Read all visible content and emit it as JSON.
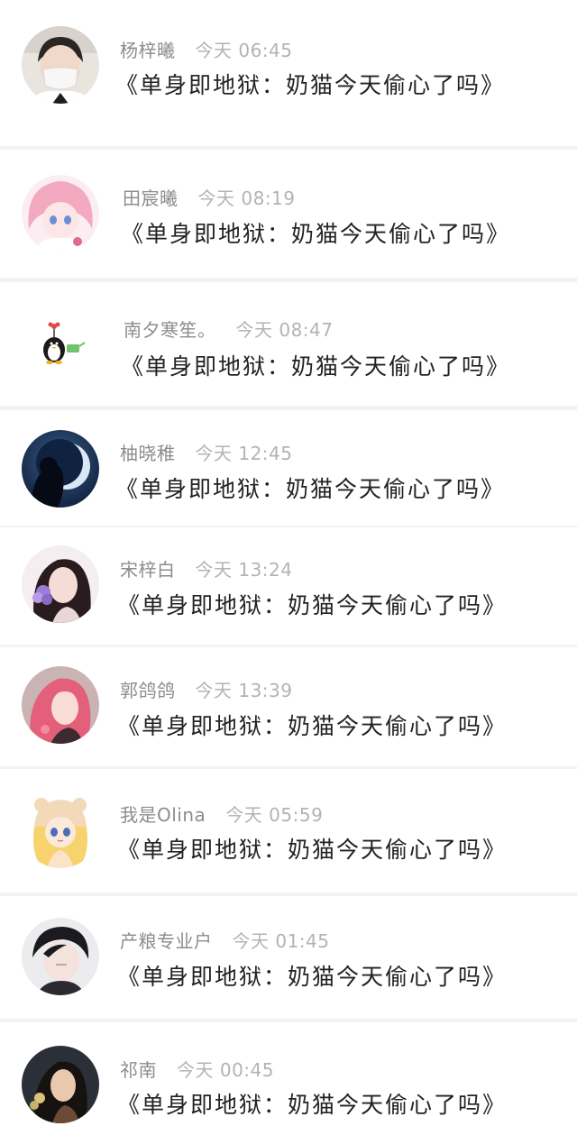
{
  "messages": [
    {
      "name": "杨梓曦",
      "time": "今天 06:45",
      "title": "《单身即地狱：奶猫今天偷心了吗》",
      "avatar": "boy-mask-avatar-icon"
    },
    {
      "name": "田宸曦",
      "time": "今天 08:19",
      "title": "《单身即地狱：奶猫今天偷心了吗》",
      "avatar": "pink-anime-girl-avatar-icon"
    },
    {
      "name": "南夕寒笙。",
      "time": "今天 08:47",
      "title": "《单身即地狱：奶猫今天偷心了吗》",
      "avatar": "penguin-with-flower-avatar-icon"
    },
    {
      "name": "柚晓稚",
      "time": "今天 12:45",
      "title": "《单身即地狱：奶猫今天偷心了吗》",
      "avatar": "moon-silhouette-avatar-icon"
    },
    {
      "name": "宋梓白",
      "time": "今天 13:24",
      "title": "《单身即地狱：奶猫今天偷心了吗》",
      "avatar": "girl-with-flowers-avatar-icon"
    },
    {
      "name": "郭鸽鸽",
      "time": "今天 13:39",
      "title": "《单身即地狱：奶猫今天偷心了吗》",
      "avatar": "pink-hair-girl-avatar-icon"
    },
    {
      "name": "我是Olina",
      "time": "今天 05:59",
      "title": "《单身即地狱：奶猫今天偷心了吗》",
      "avatar": "anime-girl-bear-hat-avatar-icon"
    },
    {
      "name": "产粮专业户",
      "time": "今天 01:45",
      "title": "《单身即地狱：奶猫今天偷心了吗》",
      "avatar": "anime-boy-avatar-icon"
    },
    {
      "name": "祁南",
      "time": "今天 00:45",
      "title": "《单身即地狱：奶猫今天偷心了吗》",
      "avatar": "girl-night-portrait-avatar-icon"
    }
  ]
}
